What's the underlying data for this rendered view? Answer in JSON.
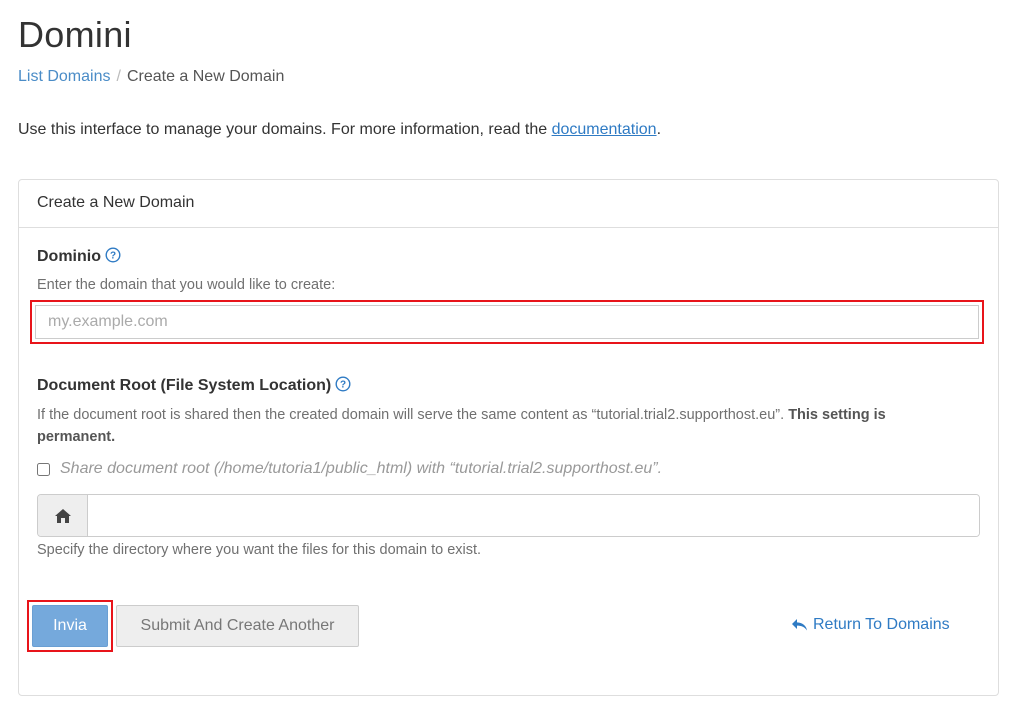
{
  "page": {
    "title": "Domini"
  },
  "breadcrumb": {
    "items": [
      {
        "label": "List Domains"
      },
      {
        "label": "Create a New Domain"
      }
    ],
    "separator": "/"
  },
  "intro": {
    "text": "Use this interface to manage your domains. For more information, read the ",
    "link": "documentation",
    "end": "."
  },
  "panel": {
    "heading": "Create a New Domain",
    "domain": {
      "label": "Dominio",
      "help": "Enter the domain that you would like to create:",
      "value": "",
      "placeholder": "my.example.com"
    },
    "docroot": {
      "label": "Document Root (File System Location)",
      "help_text": "If the document root is shared then the created domain will serve the same content as “tutorial.trial2.supporthost.eu”. ",
      "help_strong": "This setting is permanent.",
      "share_label": "Share document root (/home/tutoria1/public_html) with “tutorial.trial2.supporthost.eu”.",
      "share_checked": false,
      "value": "",
      "specify_help": "Specify the directory where you want the files for this domain to exist."
    },
    "buttons": {
      "submit": "Invia",
      "submit_another": "Submit And Create Another",
      "return": "Return To Domains"
    }
  },
  "colors": {
    "link": "#2f7bc4",
    "primary": "#75a9dc",
    "highlight": "#e8141a"
  }
}
